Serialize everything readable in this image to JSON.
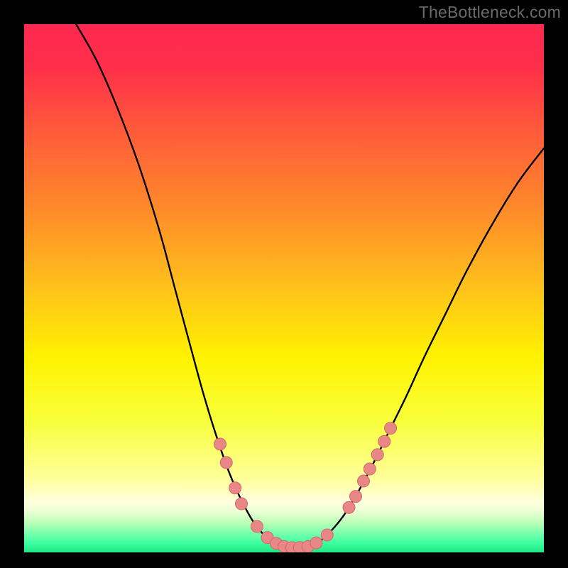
{
  "watermark": "TheBottleneck.com",
  "chart_data": {
    "type": "line",
    "title": "",
    "xlabel": "",
    "ylabel": "",
    "xlim": [
      0,
      100
    ],
    "ylim": [
      0,
      100
    ],
    "gradient_stops": [
      {
        "offset": 0.0,
        "color": "#ff2850"
      },
      {
        "offset": 0.08,
        "color": "#ff2e4a"
      },
      {
        "offset": 0.2,
        "color": "#ff5a3a"
      },
      {
        "offset": 0.35,
        "color": "#ff8a2a"
      },
      {
        "offset": 0.5,
        "color": "#ffc21a"
      },
      {
        "offset": 0.63,
        "color": "#fff200"
      },
      {
        "offset": 0.75,
        "color": "#f8ff3a"
      },
      {
        "offset": 0.86,
        "color": "#ffff9a"
      },
      {
        "offset": 0.905,
        "color": "#ffffe0"
      },
      {
        "offset": 0.926,
        "color": "#e6ffd0"
      },
      {
        "offset": 0.945,
        "color": "#b6ffb6"
      },
      {
        "offset": 0.963,
        "color": "#7cffad"
      },
      {
        "offset": 0.982,
        "color": "#3dffa0"
      },
      {
        "offset": 1.0,
        "color": "#1fe884"
      }
    ],
    "series": [
      {
        "name": "curve",
        "stroke": "#000000",
        "stroke_width": 2.4,
        "points": [
          {
            "x": 10.0,
            "y": 100.0
          },
          {
            "x": 14.0,
            "y": 93.0
          },
          {
            "x": 18.0,
            "y": 84.0
          },
          {
            "x": 22.0,
            "y": 73.5
          },
          {
            "x": 26.0,
            "y": 61.0
          },
          {
            "x": 29.0,
            "y": 50.0
          },
          {
            "x": 32.0,
            "y": 39.0
          },
          {
            "x": 34.5,
            "y": 30.0
          },
          {
            "x": 37.0,
            "y": 22.0
          },
          {
            "x": 39.5,
            "y": 15.0
          },
          {
            "x": 42.0,
            "y": 9.5
          },
          {
            "x": 44.5,
            "y": 5.2
          },
          {
            "x": 47.0,
            "y": 2.6
          },
          {
            "x": 49.0,
            "y": 1.4
          },
          {
            "x": 51.0,
            "y": 1.0
          },
          {
            "x": 53.0,
            "y": 1.0
          },
          {
            "x": 55.0,
            "y": 1.2
          },
          {
            "x": 57.0,
            "y": 2.2
          },
          {
            "x": 59.0,
            "y": 4.0
          },
          {
            "x": 61.5,
            "y": 7.0
          },
          {
            "x": 64.0,
            "y": 11.0
          },
          {
            "x": 67.0,
            "y": 16.5
          },
          {
            "x": 70.0,
            "y": 22.5
          },
          {
            "x": 73.5,
            "y": 29.5
          },
          {
            "x": 77.0,
            "y": 37.0
          },
          {
            "x": 81.0,
            "y": 45.0
          },
          {
            "x": 85.0,
            "y": 53.0
          },
          {
            "x": 90.0,
            "y": 62.0
          },
          {
            "x": 95.0,
            "y": 70.0
          },
          {
            "x": 100.0,
            "y": 76.5
          }
        ]
      }
    ],
    "markers": {
      "name": "highlight-dots",
      "fill": "#e98686",
      "stroke": "#d06a6a",
      "radius": 8.5,
      "points": [
        {
          "x": 37.7,
          "y": 20.5
        },
        {
          "x": 38.9,
          "y": 17.0
        },
        {
          "x": 40.6,
          "y": 12.2
        },
        {
          "x": 41.8,
          "y": 9.2
        },
        {
          "x": 44.8,
          "y": 4.9
        },
        {
          "x": 46.8,
          "y": 2.8
        },
        {
          "x": 48.5,
          "y": 1.7
        },
        {
          "x": 50.0,
          "y": 1.1
        },
        {
          "x": 51.5,
          "y": 0.9
        },
        {
          "x": 53.0,
          "y": 0.9
        },
        {
          "x": 54.6,
          "y": 1.1
        },
        {
          "x": 56.2,
          "y": 1.8
        },
        {
          "x": 58.3,
          "y": 3.3
        },
        {
          "x": 62.5,
          "y": 8.5
        },
        {
          "x": 63.8,
          "y": 10.6
        },
        {
          "x": 65.3,
          "y": 13.5
        },
        {
          "x": 66.5,
          "y": 15.8
        },
        {
          "x": 68.0,
          "y": 18.5
        },
        {
          "x": 69.3,
          "y": 21.0
        },
        {
          "x": 70.5,
          "y": 23.5
        }
      ]
    }
  }
}
